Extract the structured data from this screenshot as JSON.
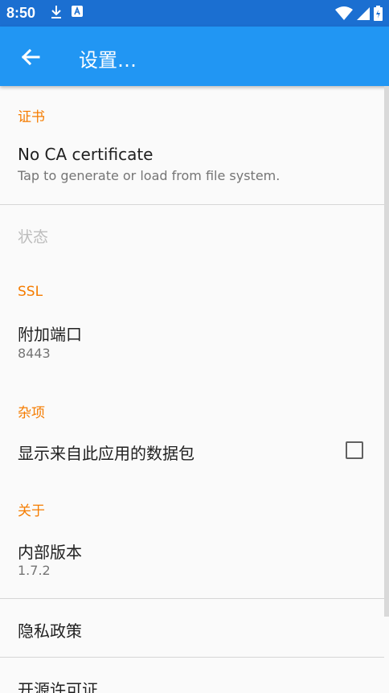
{
  "status_bar": {
    "time": "8:50",
    "icons": [
      "download-icon",
      "app-notification-icon",
      "wifi-icon",
      "signal-icon",
      "battery-charging-icon"
    ]
  },
  "app_bar": {
    "title": "设置…",
    "back_icon": "arrow-back-icon"
  },
  "colors": {
    "status_bar": "#1b6fd1",
    "app_bar": "#2196f3",
    "category": "#f57c00"
  },
  "sections": {
    "certificate": {
      "header": "证书",
      "title": "No CA certificate",
      "summary": "Tap to generate or load from file system."
    },
    "status": {
      "title": "状态"
    },
    "ssl": {
      "header": "SSL",
      "title": "附加端口",
      "summary": "8443"
    },
    "misc": {
      "header": "杂项",
      "title": "显示来自此应用的数据包",
      "checked": false
    },
    "about": {
      "header": "关于",
      "build_title": "内部版本",
      "build_version": "1.7.2",
      "privacy": "隐私政策",
      "licenses": "开源许可证"
    }
  }
}
